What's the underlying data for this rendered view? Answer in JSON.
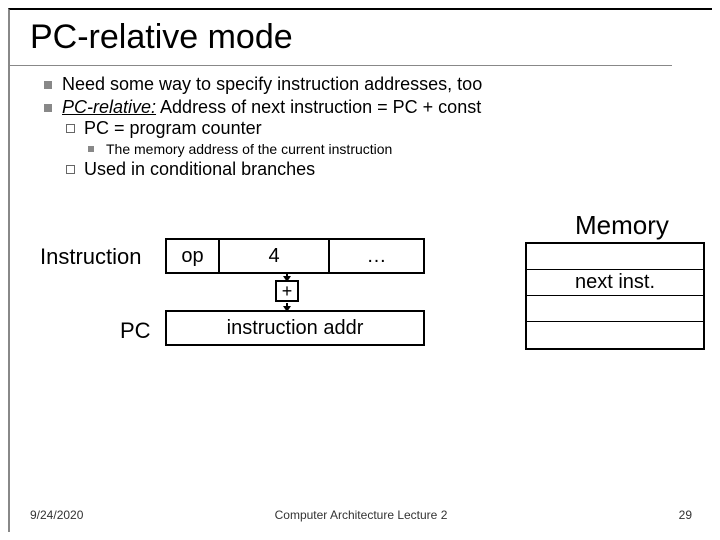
{
  "title": "PC-relative mode",
  "bullets": {
    "b1": "Need some way to specify instruction addresses, too",
    "b2_prefix": "PC-relative:",
    "b2_rest": " Address of next instruction = PC + const",
    "b2a": "PC = program counter",
    "b2a1": "The memory address of the current instruction",
    "b2b": "Used in conditional branches"
  },
  "diagram": {
    "instruction_label": "Instruction",
    "op": "op",
    "const": "4",
    "dots": "…",
    "plus": "+",
    "pc_label": "PC",
    "iaddr": "instruction addr",
    "memory_label": "Memory",
    "memory_rows": [
      "",
      "next inst.",
      "",
      ""
    ]
  },
  "footer": {
    "date": "9/24/2020",
    "lecture": "Computer Architecture Lecture 2",
    "page": "29"
  }
}
